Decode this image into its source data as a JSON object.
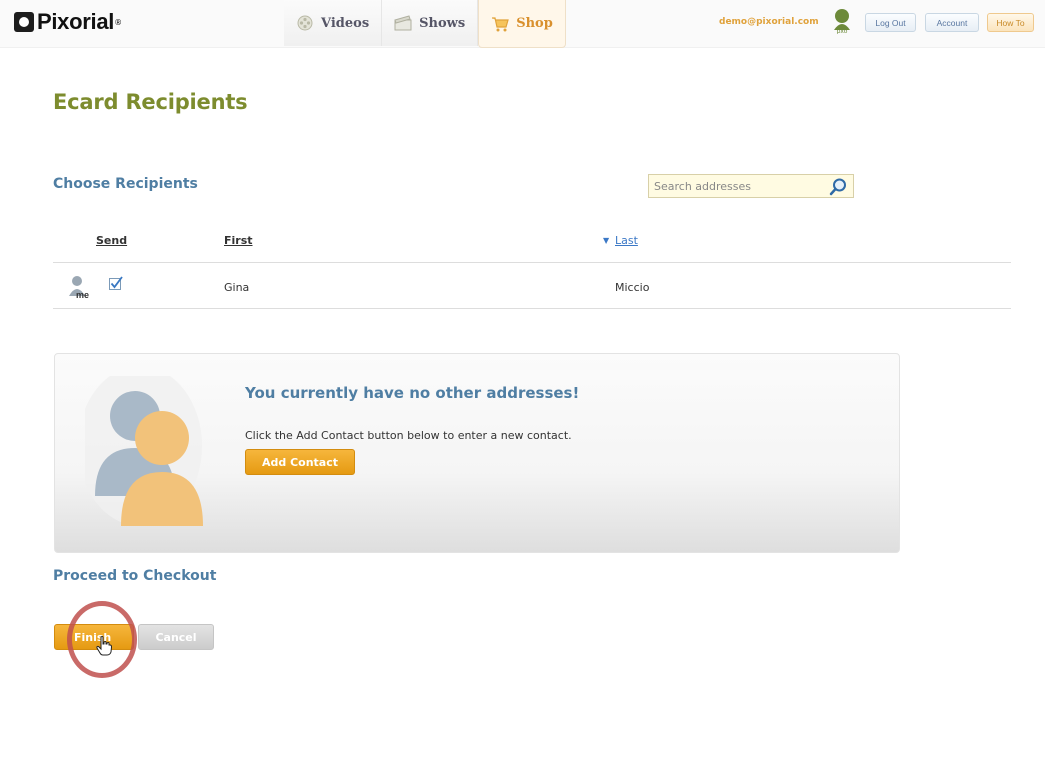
{
  "header": {
    "logo": "Pixorial",
    "logo_mark": "®",
    "nav": [
      {
        "label": "Videos",
        "icon": "film-reel-icon"
      },
      {
        "label": "Shows",
        "icon": "clapperboard-icon"
      },
      {
        "label": "Shop",
        "icon": "shopping-cart-icon"
      }
    ],
    "user_email": "demo@pixorial.com",
    "avatar_initials": "pxo",
    "buttons": {
      "logout": "Log Out",
      "account": "Account",
      "howto": "How To"
    }
  },
  "page_title": "Ecard Recipients",
  "recipients": {
    "section_title": "Choose Recipients",
    "search_placeholder": "Search addresses",
    "columns": {
      "send": "Send",
      "first": "First",
      "last": "Last",
      "sort_indicator": "▼"
    },
    "rows": [
      {
        "badge": "me",
        "checked": true,
        "first": "Gina",
        "last": "Miccio"
      }
    ]
  },
  "empty_state": {
    "title": "You currently have no other addresses!",
    "text": "Click the Add Contact button below to enter a new contact.",
    "button": "Add Contact"
  },
  "checkout": {
    "section_title": "Proceed to Checkout",
    "finish": "Finish",
    "cancel": "Cancel"
  },
  "colors": {
    "title_green": "#7d8c2e",
    "section_blue": "#4f7ea3",
    "accent_orange": "#e59a12",
    "link_blue": "#3b78c6"
  }
}
